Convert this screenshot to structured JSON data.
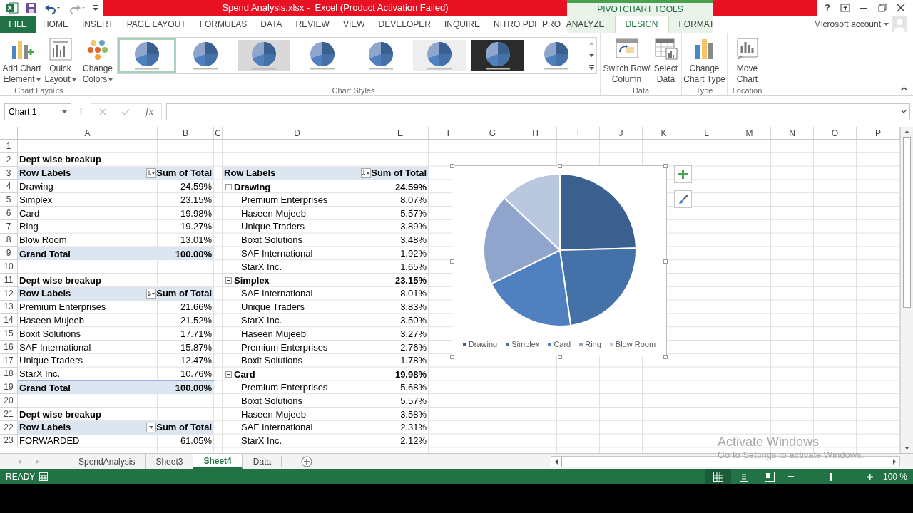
{
  "title_bar": {
    "title": "Spend Analysis.xlsx -  Excel (Product Activation Failed)",
    "contextual_group": "PIVOTCHART TOOLS",
    "help": "?"
  },
  "ribbon_tabs": [
    {
      "label": "FILE",
      "kind": "file",
      "selected": false
    },
    {
      "label": "HOME",
      "kind": "normal",
      "selected": false
    },
    {
      "label": "INSERT",
      "kind": "normal",
      "selected": false
    },
    {
      "label": "PAGE LAYOUT",
      "kind": "normal",
      "selected": false
    },
    {
      "label": "FORMULAS",
      "kind": "normal",
      "selected": false
    },
    {
      "label": "DATA",
      "kind": "normal",
      "selected": false
    },
    {
      "label": "REVIEW",
      "kind": "normal",
      "selected": false
    },
    {
      "label": "VIEW",
      "kind": "normal",
      "selected": false
    },
    {
      "label": "DEVELOPER",
      "kind": "normal",
      "selected": false
    },
    {
      "label": "INQUIRE",
      "kind": "normal",
      "selected": false
    },
    {
      "label": "NITRO PDF PRO",
      "kind": "normal",
      "selected": false
    },
    {
      "label": "ANALYZE",
      "kind": "contextual",
      "selected": false
    },
    {
      "label": "DESIGN",
      "kind": "contextual",
      "selected": true
    },
    {
      "label": "FORMAT",
      "kind": "contextual",
      "selected": false
    }
  ],
  "account": "Microsoft account",
  "ribbon": {
    "chart_layouts": {
      "label": "Chart Layouts",
      "buttons": [
        {
          "lines": [
            "Add Chart",
            "Element"
          ],
          "dropdown": true
        },
        {
          "lines": [
            "Quick",
            "Layout"
          ],
          "dropdown": true
        }
      ]
    },
    "chart_styles": {
      "label": "Chart Styles",
      "colors_button": {
        "lines": [
          "Change",
          "Colors"
        ],
        "dropdown": true
      },
      "styles": [
        {
          "selected": true
        },
        {
          "selected": false
        },
        {
          "selected": false
        },
        {
          "selected": false
        },
        {
          "selected": false
        },
        {
          "selected": false
        },
        {
          "selected": false
        },
        {
          "selected": false
        }
      ]
    },
    "data": {
      "label": "Data",
      "buttons": [
        {
          "lines": [
            "Switch Row/",
            "Column"
          ]
        },
        {
          "lines": [
            "Select",
            "Data"
          ]
        }
      ]
    },
    "type": {
      "label": "Type",
      "buttons": [
        {
          "lines": [
            "Change",
            "Chart Type"
          ]
        }
      ]
    },
    "location": {
      "label": "Location",
      "buttons": [
        {
          "lines": [
            "Move",
            "Chart"
          ]
        }
      ]
    }
  },
  "formula_bar": {
    "name_box": "Chart 1",
    "fx": "fx"
  },
  "sheet": {
    "columns": [
      "A",
      "B",
      "C",
      "D",
      "E",
      "F",
      "G",
      "H",
      "I",
      "J",
      "K",
      "L",
      "M",
      "N",
      "O",
      "P"
    ],
    "rows": [
      {
        "number": "1",
        "cells": {}
      },
      {
        "number": "2",
        "cells": {
          "A": {
            "text": "Dept wise breakup",
            "kind": "title"
          }
        }
      },
      {
        "number": "3",
        "cells": {
          "A": {
            "text": "Row Labels",
            "kind": "header_label",
            "filter_button": true,
            "sorted": true
          },
          "B": {
            "text": "Sum of Total",
            "kind": "header_value"
          },
          "D": {
            "text": "Row Labels",
            "kind": "header_label",
            "filter_button": true,
            "sorted": true
          },
          "E": {
            "text": "Sum of Total",
            "kind": "header_value"
          }
        }
      },
      {
        "number": "4",
        "cells": {
          "A": {
            "text": "Drawing",
            "kind": "label"
          },
          "B": {
            "text": "24.59%",
            "kind": "value"
          },
          "D": {
            "text": "Drawing",
            "kind": "group_label",
            "expanded": true
          },
          "E": {
            "text": "24.59%",
            "kind": "group_value"
          }
        }
      },
      {
        "number": "5",
        "cells": {
          "A": {
            "text": "Simplex",
            "kind": "label"
          },
          "B": {
            "text": "23.15%",
            "kind": "value"
          },
          "D": {
            "text": "Premium Enterprises",
            "kind": "item"
          },
          "E": {
            "text": "8.07%",
            "kind": "value"
          }
        }
      },
      {
        "number": "6",
        "cells": {
          "A": {
            "text": "Card",
            "kind": "label"
          },
          "B": {
            "text": "19.98%",
            "kind": "value"
          },
          "D": {
            "text": "Haseen Mujeeb",
            "kind": "item"
          },
          "E": {
            "text": "5.57%",
            "kind": "value"
          }
        }
      },
      {
        "number": "7",
        "cells": {
          "A": {
            "text": "Ring",
            "kind": "label"
          },
          "B": {
            "text": "19.27%",
            "kind": "value"
          },
          "D": {
            "text": "Unique Traders",
            "kind": "item"
          },
          "E": {
            "text": "3.89%",
            "kind": "value"
          }
        }
      },
      {
        "number": "8",
        "cells": {
          "A": {
            "text": "Blow Room",
            "kind": "label"
          },
          "B": {
            "text": "13.01%",
            "kind": "value"
          },
          "D": {
            "text": "Boxit Solutions",
            "kind": "item"
          },
          "E": {
            "text": "3.48%",
            "kind": "value"
          }
        }
      },
      {
        "number": "9",
        "cells": {
          "A": {
            "text": "Grand Total",
            "kind": "total_label"
          },
          "B": {
            "text": "100.00%",
            "kind": "total_value"
          },
          "D": {
            "text": "SAF International",
            "kind": "item"
          },
          "E": {
            "text": "1.92%",
            "kind": "value"
          }
        }
      },
      {
        "number": "10",
        "cells": {
          "D": {
            "text": "StarX Inc.",
            "kind": "item"
          },
          "E": {
            "text": "1.65%",
            "kind": "value"
          }
        }
      },
      {
        "number": "11",
        "cells": {
          "A": {
            "text": "Dept wise breakup",
            "kind": "title"
          },
          "D": {
            "text": "Simplex",
            "kind": "group_label",
            "expanded": true
          },
          "E": {
            "text": "23.15%",
            "kind": "group_value"
          }
        }
      },
      {
        "number": "12",
        "cells": {
          "A": {
            "text": "Row Labels",
            "kind": "header_label",
            "filter_button": true,
            "sorted": true
          },
          "B": {
            "text": "Sum of Total",
            "kind": "header_value"
          },
          "D": {
            "text": "SAF International",
            "kind": "item"
          },
          "E": {
            "text": "8.01%",
            "kind": "value"
          }
        }
      },
      {
        "number": "13",
        "cells": {
          "A": {
            "text": "Premium Enterprises",
            "kind": "label"
          },
          "B": {
            "text": "21.66%",
            "kind": "value"
          },
          "D": {
            "text": "Unique Traders",
            "kind": "item"
          },
          "E": {
            "text": "3.83%",
            "kind": "value"
          }
        }
      },
      {
        "number": "14",
        "cells": {
          "A": {
            "text": "Haseen Mujeeb",
            "kind": "label"
          },
          "B": {
            "text": "21.52%",
            "kind": "value"
          },
          "D": {
            "text": "StarX Inc.",
            "kind": "item"
          },
          "E": {
            "text": "3.50%",
            "kind": "value"
          }
        }
      },
      {
        "number": "15",
        "cells": {
          "A": {
            "text": "Boxit Solutions",
            "kind": "label"
          },
          "B": {
            "text": "17.71%",
            "kind": "value"
          },
          "D": {
            "text": "Haseen Mujeeb",
            "kind": "item"
          },
          "E": {
            "text": "3.27%",
            "kind": "value"
          }
        }
      },
      {
        "number": "16",
        "cells": {
          "A": {
            "text": "SAF International",
            "kind": "label"
          },
          "B": {
            "text": "15.87%",
            "kind": "value"
          },
          "D": {
            "text": "Premium Enterprises",
            "kind": "item"
          },
          "E": {
            "text": "2.76%",
            "kind": "value"
          }
        }
      },
      {
        "number": "17",
        "cells": {
          "A": {
            "text": "Unique Traders",
            "kind": "label"
          },
          "B": {
            "text": "12.47%",
            "kind": "value"
          },
          "D": {
            "text": "Boxit Solutions",
            "kind": "item"
          },
          "E": {
            "text": "1.78%",
            "kind": "value"
          }
        }
      },
      {
        "number": "18",
        "cells": {
          "A": {
            "text": "StarX Inc.",
            "kind": "label"
          },
          "B": {
            "text": "10.76%",
            "kind": "value"
          },
          "D": {
            "text": "Card",
            "kind": "group_label",
            "expanded": true
          },
          "E": {
            "text": "19.98%",
            "kind": "group_value"
          }
        }
      },
      {
        "number": "19",
        "cells": {
          "A": {
            "text": "Grand Total",
            "kind": "total_label"
          },
          "B": {
            "text": "100.00%",
            "kind": "total_value"
          },
          "D": {
            "text": "Premium Enterprises",
            "kind": "item"
          },
          "E": {
            "text": "5.68%",
            "kind": "value"
          }
        }
      },
      {
        "number": "20",
        "cells": {
          "D": {
            "text": "Boxit Solutions",
            "kind": "item"
          },
          "E": {
            "text": "5.57%",
            "kind": "value"
          }
        }
      },
      {
        "number": "21",
        "cells": {
          "A": {
            "text": "Dept wise breakup",
            "kind": "title"
          },
          "D": {
            "text": "Haseen Mujeeb",
            "kind": "item"
          },
          "E": {
            "text": "3.58%",
            "kind": "value"
          }
        }
      },
      {
        "number": "22",
        "cells": {
          "A": {
            "text": "Row Labels",
            "kind": "header_label",
            "filter_button": true,
            "sorted": false
          },
          "B": {
            "text": "Sum of Total",
            "kind": "header_value"
          },
          "D": {
            "text": "SAF International",
            "kind": "item"
          },
          "E": {
            "text": "2.31%",
            "kind": "value"
          }
        }
      },
      {
        "number": "23",
        "cells": {
          "A": {
            "text": "FORWARDED",
            "kind": "label"
          },
          "B": {
            "text": "61.05%",
            "kind": "value"
          },
          "D": {
            "text": "StarX Inc.",
            "kind": "item"
          },
          "E": {
            "text": "2.12%",
            "kind": "value"
          }
        }
      }
    ],
    "chart": {
      "chart_data": {
        "type": "pie",
        "legend": "bottom",
        "categories": [
          "Drawing",
          "Simplex",
          "Card",
          "Ring",
          "Blow Room"
        ],
        "series": [
          {
            "colors": [
              "#3b5f8f",
              "#4472a8",
              "#4f80bf",
              "#8fa5cc",
              "#b9c7df"
            ],
            "values": [
              24.59,
              23.15,
              19.98,
              19.27,
              13.01
            ]
          }
        ]
      }
    }
  },
  "sheet_tabs": [
    {
      "label": "SpendAnalysis",
      "selected": false
    },
    {
      "label": "Sheet3",
      "selected": false
    },
    {
      "label": "Sheet4",
      "selected": true
    },
    {
      "label": "Data",
      "selected": false
    }
  ],
  "status_bar": {
    "mode": "READY",
    "views": [
      {
        "selected": true
      },
      {
        "selected": false
      },
      {
        "selected": false
      }
    ],
    "zoom": {
      "level": 0.5,
      "reading": "100 %"
    }
  },
  "system_notice": {
    "title": "Activate Windows",
    "subtitle": "Go to Settings to activate Windows."
  }
}
